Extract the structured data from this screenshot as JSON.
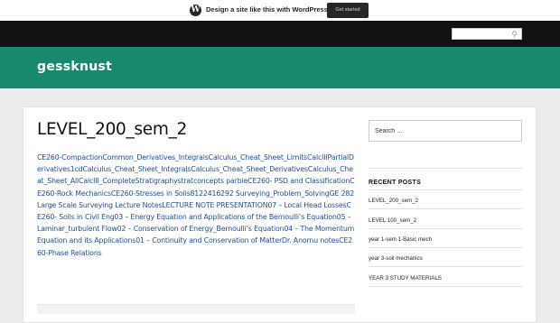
{
  "wp_banner": {
    "logo_glyph": "W",
    "text": "Design a site like this with WordPress.com",
    "button_label": "Get started"
  },
  "site": {
    "title": "gessknust"
  },
  "post": {
    "title": "LEVEL_200_sem_2",
    "content": "CE260-CompactionCommon_Derivatives_IntegralsCalculus_Cheat_Sheet_LimitsCalcIIIPartialDerivatives1cdCalculus_Cheat_Sheet_IntegralsCalculus_Cheat_Sheet_DerivativesCalculus_Cheat_Sheet_AllCalcIII_CompleteStratigraphystratconcepts parbieCE260- PSD and ClassificationCE260-Rock MechanicsCE260-Stresses in Soils8122416292 Surveying_Problem_SolvingGE 282 Large Scale Surveying Lecture NotesLECTURE NOTE PRESENTATION07 – Local Head LossesCE260- Soils in Civil Eng03 – Energy Equation and Applications of the Bernoulli’s Equation05 – Laminar_turbulent Flow02 – Conservation of Energy_Bernoulli’s Equation04 – The Momentum Equation and its Applications01 – Continuity and Conservation of MatterDr. Anornu notesCE260-Phase Relations"
  },
  "sidebar": {
    "search_placeholder": "Search …",
    "recent_posts_heading": "RECENT POSTS",
    "recent_posts": [
      "LEVEL_200_sem_2",
      "LEVEL 100_sem_2",
      "year 1-sem 1-Basic mech",
      "year 3-soil mechanics",
      "YEAR 3 STUDY MATERIALS"
    ]
  },
  "colors": {
    "header_bg": "#18896d",
    "topnav_bg": "#121212",
    "link": "#1e4e93"
  }
}
